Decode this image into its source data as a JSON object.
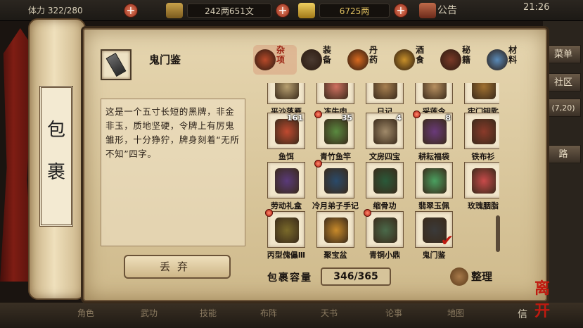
{
  "topbar": {
    "stamina": "322/280",
    "money": "242两651文",
    "gold": "6725两",
    "announce": "公告",
    "clock": "21:26",
    "left_partial": "体力"
  },
  "scroll_label": "包裹",
  "selected_item": {
    "name": "鬼门鉴",
    "description": "这是一个五寸长短的黑牌，非金非玉，质地坚硬，令牌上有厉鬼雏形，十分狰狞，牌身刻着“无所不知”四字。"
  },
  "discard_label": "丢弃",
  "categories": [
    {
      "label": "杂项",
      "selected": true,
      "color": "#b84a2a"
    },
    {
      "label": "装备",
      "selected": false,
      "color": "#4a3a30"
    },
    {
      "label": "丹药",
      "selected": false,
      "color": "#d86a20"
    },
    {
      "label": "酒食",
      "selected": false,
      "color": "#c8902a"
    },
    {
      "label": "秘籍",
      "selected": false,
      "color": "#7a3a28"
    },
    {
      "label": "材料",
      "selected": false,
      "color": "#5a8ab8"
    }
  ],
  "grid_rows": [
    [
      {
        "name": "平沙落雁",
        "count": "",
        "dot": false,
        "color": "#b8a070"
      },
      {
        "name": "冻牛肉",
        "count": "",
        "dot": false,
        "color": "#d07060"
      },
      {
        "name": "日记",
        "count": "",
        "dot": false,
        "color": "#a88050"
      },
      {
        "name": "采莲令",
        "count": "",
        "dot": false,
        "color": "#b89060"
      },
      {
        "name": "牢门钥匙",
        "count": "",
        "dot": false,
        "color": "#a07030"
      }
    ],
    [
      {
        "name": "鱼饵",
        "count": "161",
        "dot": false,
        "color": "#c04a30"
      },
      {
        "name": "青竹鱼竿",
        "count": "35",
        "dot": true,
        "color": "#5a8a40"
      },
      {
        "name": "文房四宝",
        "count": "4",
        "dot": false,
        "color": "#a08a6a"
      },
      {
        "name": "耕耘福袋",
        "count": "8",
        "dot": true,
        "color": "#6a3a7a"
      },
      {
        "name": "铁布衫",
        "count": "",
        "dot": false,
        "color": "#8a3a2a"
      }
    ],
    [
      {
        "name": "劳动礼盒",
        "count": "",
        "dot": false,
        "color": "#5a3a7a"
      },
      {
        "name": "冷月弟子手记",
        "count": "",
        "dot": true,
        "color": "#2a4a6a"
      },
      {
        "name": "缩骨功",
        "count": "",
        "dot": false,
        "color": "#2a5a3a"
      },
      {
        "name": "翡翠玉佩",
        "count": "",
        "dot": false,
        "color": "#4aa060"
      },
      {
        "name": "玫瑰胭脂",
        "count": "",
        "dot": false,
        "color": "#c84a4a"
      }
    ],
    [
      {
        "name": "丙型傀儡Ⅲ",
        "count": "",
        "dot": true,
        "color": "#7a6a2a"
      },
      {
        "name": "聚宝盆",
        "count": "",
        "dot": false,
        "color": "#c88a2a"
      },
      {
        "name": "青铜小鼎",
        "count": "",
        "dot": true,
        "color": "#4a6a4a"
      },
      {
        "name": "鬼门鉴",
        "count": "",
        "dot": false,
        "color": "#3a3a3a",
        "checked": true
      }
    ]
  ],
  "capacity_label": "包裹容量",
  "capacity_value": "346/365",
  "sort_label": "整理",
  "right_tabs": [
    "菜单",
    "社区",
    "(7,20)",
    "路"
  ],
  "bottom_tabs": [
    "角色",
    "武功",
    "技能",
    "布阵",
    "天书",
    "论事",
    "地图",
    "信"
  ]
}
